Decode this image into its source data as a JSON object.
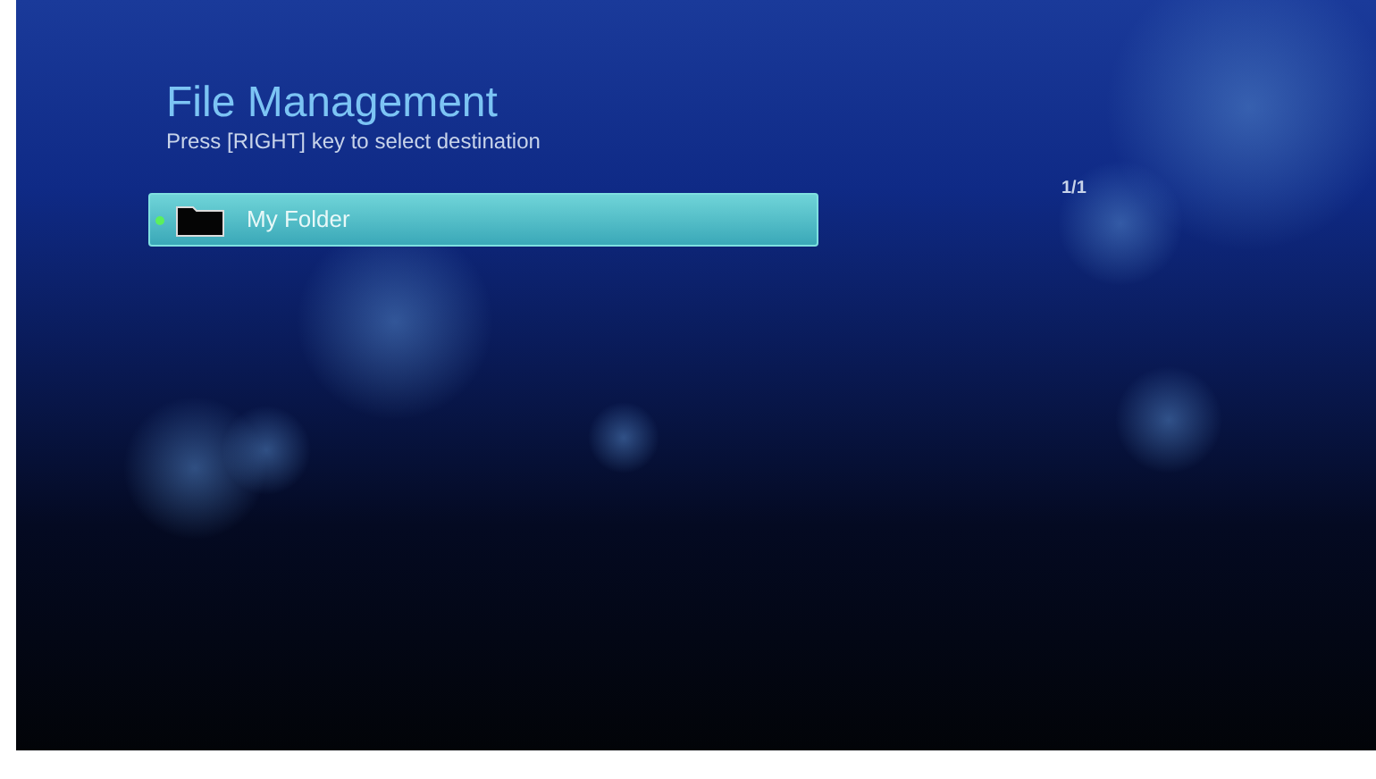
{
  "title": "File Management",
  "subtitle": "Press [RIGHT] key to select destination",
  "page_indicator": "1/1",
  "items": [
    {
      "label": "My Folder",
      "selected": true
    }
  ]
}
